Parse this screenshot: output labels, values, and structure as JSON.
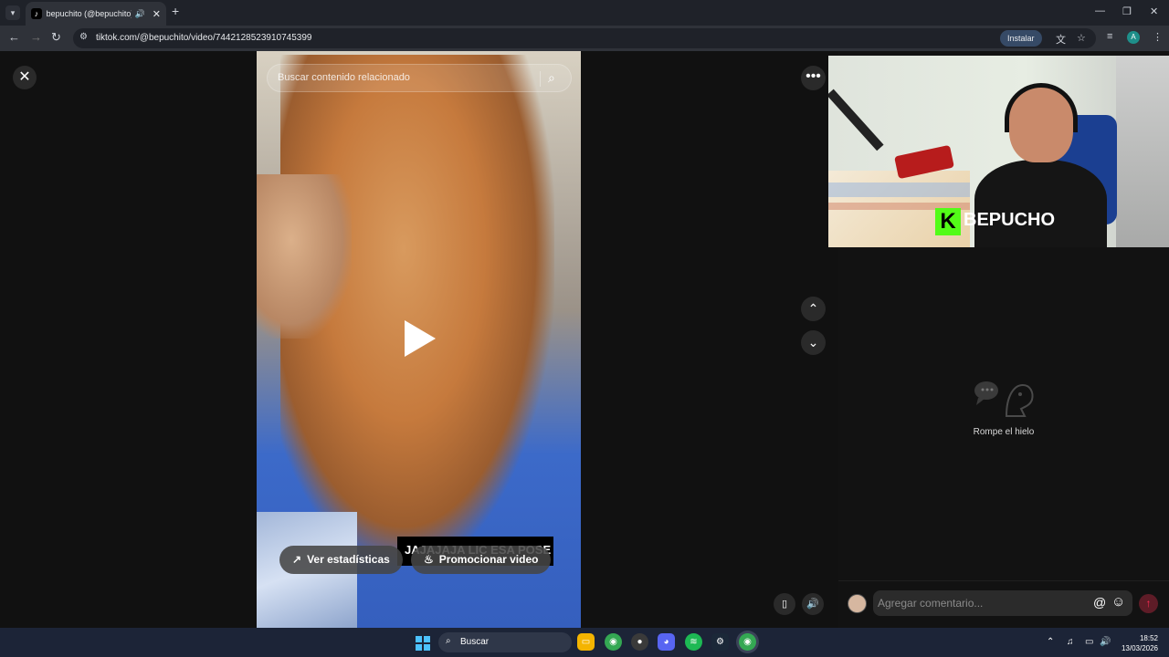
{
  "browser": {
    "tab_title": "bepuchito (@bepuchito) | TikTok",
    "url": "tiktok.com/@bepuchito/video/7442128523910745399",
    "install_label": "Instalar",
    "profile_initial": "A"
  },
  "icons": {
    "tab_list": "chevron-down-icon",
    "tab_favicon": "tiktok-icon",
    "new_tab": "plus-icon",
    "back": "arrow-left-icon",
    "forward": "arrow-right-icon",
    "reload": "reload-icon",
    "site_info": "sliders-icon",
    "translate": "translate-icon",
    "bookmark": "star-icon",
    "tab_search": "tab-search-icon",
    "menu": "kebab-icon"
  },
  "video": {
    "search_placeholder": "Buscar contenido relacionado",
    "caption": "JAJAJAJA LIC ESA POSE",
    "stats_label": "Ver estadísticas",
    "promote_label": "Promocionar video"
  },
  "webcam": {
    "logo_letter": "K",
    "logo_name": "BEPUCHO"
  },
  "comments": {
    "empty_text": "Rompe el hielo",
    "placeholder": "Agregar comentario...",
    "mention": "@"
  },
  "taskbar": {
    "search_label": "Buscar",
    "time": "18:52",
    "date": "13/03/2026",
    "pinned_apps": [
      "file-explorer",
      "chrome",
      "obs",
      "discord",
      "spotify",
      "steam",
      "chrome-profile"
    ]
  },
  "colors": {
    "accent": "#fe2c55",
    "kick_green": "#53fc18",
    "windows_blue": "#4cc2ff"
  }
}
